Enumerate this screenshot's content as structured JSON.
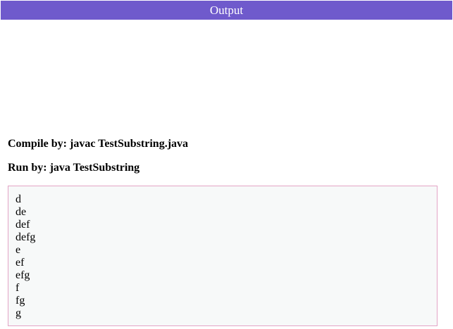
{
  "header": {
    "title": "Output"
  },
  "commands": {
    "compile": "Compile by: javac TestSubstring.java",
    "run": "Run by: java TestSubstring"
  },
  "output": {
    "lines": [
      "d",
      "de",
      "def",
      "defg",
      "e",
      "ef",
      "efg",
      "f",
      "fg",
      "g"
    ]
  },
  "colors": {
    "header_background": "#6f5acc",
    "header_text": "#ffffff",
    "output_border": "#e3a4c6",
    "output_background": "#f7f9f9"
  }
}
